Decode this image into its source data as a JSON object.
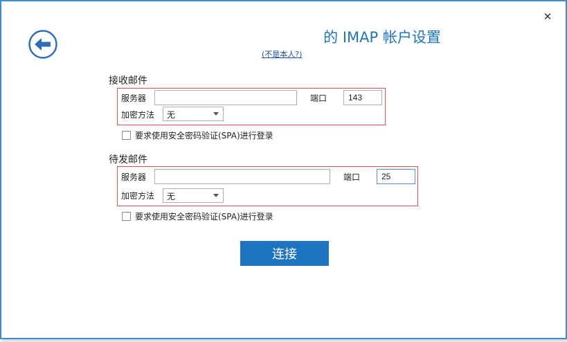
{
  "dialog": {
    "title": "的 IMAP 帐户设置",
    "not_you_link": "(不是本人?)",
    "close_glyph": "✕"
  },
  "incoming": {
    "section_title": "接收邮件",
    "server_label": "服务器",
    "server_value": "",
    "port_label": "端口",
    "port_value": "143",
    "encryption_label": "加密方法",
    "encryption_value": "无",
    "spa_label": "要求使用安全密码验证(SPA)进行登录",
    "spa_checked": false
  },
  "outgoing": {
    "section_title": "待发邮件",
    "server_label": "服务器",
    "server_value": "",
    "port_label": "端口",
    "port_value": "25",
    "encryption_label": "加密方法",
    "encryption_value": "无",
    "spa_label": "要求使用安全密码验证(SPA)进行登录",
    "spa_checked": false
  },
  "actions": {
    "connect_label": "连接"
  },
  "icons": {
    "back": "back-arrow-icon",
    "close": "close-icon",
    "dropdown": "chevron-down-icon"
  },
  "colors": {
    "accent": "#1f74c2",
    "window_border": "#3b8ed6",
    "group_border": "#d9534f"
  }
}
